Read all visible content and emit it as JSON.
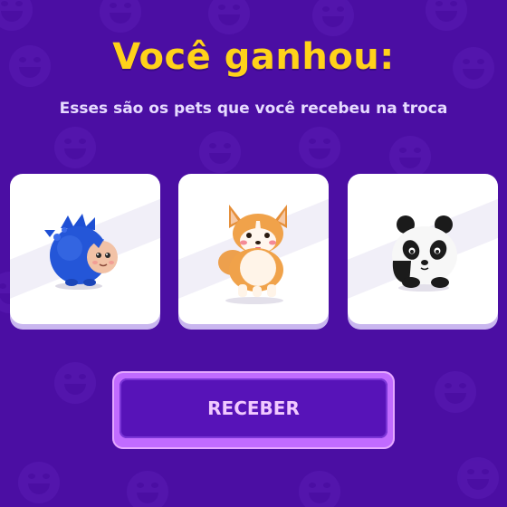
{
  "header": {
    "title": "Você ganhou:",
    "subtitle": "Esses são os pets que você recebeu na troca"
  },
  "rewards": [
    {
      "pet": "blue-hedgehog-pet-icon"
    },
    {
      "pet": "corgi-pet-icon"
    },
    {
      "pet": "panda-pet-icon"
    }
  ],
  "action": {
    "receive_label": "RECEBER"
  },
  "colors": {
    "background": "#4b0ea3",
    "title": "#ffd21a",
    "button_border": "#c16bff",
    "button_fill": "#5713b8",
    "button_text": "#f1c9ff"
  }
}
